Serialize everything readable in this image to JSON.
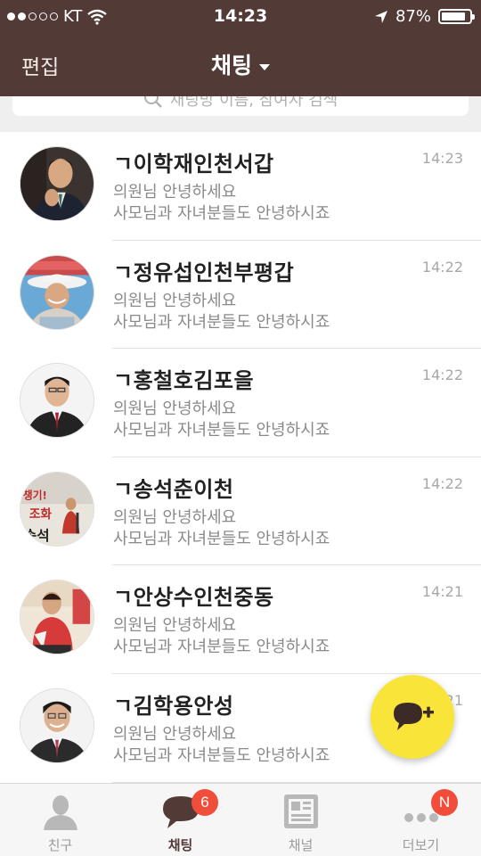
{
  "status_bar": {
    "carrier": "KT",
    "time": "14:23",
    "battery": "87%",
    "battery_level": 0.87
  },
  "header": {
    "edit_label": "편집",
    "title": "채팅"
  },
  "search": {
    "placeholder": "채팅방 이름, 참여자 검색"
  },
  "chats": [
    {
      "name": "ㄱ이학재인천서갑",
      "time": "14:23",
      "line1": "의원님 안녕하세요",
      "line2": "사모님과 자녀분들도 안녕하시죠"
    },
    {
      "name": "ㄱ정유섭인천부평갑",
      "time": "14:22",
      "line1": "의원님 안녕하세요",
      "line2": "사모님과 자녀분들도 안녕하시죠"
    },
    {
      "name": "ㄱ홍철호김포을",
      "time": "14:22",
      "line1": "의원님 안녕하세요",
      "line2": "사모님과 자녀분들도 안녕하시죠"
    },
    {
      "name": "ㄱ송석춘이천",
      "time": "14:22",
      "line1": "의원님 안녕하세요",
      "line2": "사모님과 자녀분들도 안녕하시죠"
    },
    {
      "name": "ㄱ안상수인천중동",
      "time": "14:21",
      "line1": "의원님 안녕하세요",
      "line2": "사모님과 자녀분들도 안녕하시죠"
    },
    {
      "name": "ㄱ김학용안성",
      "time": "14:21",
      "line1": "의원님 안녕하세요",
      "line2": "사모님과 자녀분들도 안녕하시죠"
    }
  ],
  "avatar_texts": {
    "poster_line1": "챙기!",
    "poster_line2": "조화",
    "poster_line3": "송석"
  },
  "tabs": [
    {
      "label": "친구",
      "icon": "person-icon"
    },
    {
      "label": "채팅",
      "icon": "chat-bubble-icon",
      "badge": "6"
    },
    {
      "label": "채널",
      "icon": "channel-icon"
    },
    {
      "label": "더보기",
      "icon": "more-dots-icon",
      "badge": "N"
    }
  ],
  "colors": {
    "header_bg": "#523a36",
    "fab_bg": "#f9e53a",
    "badge_bg": "#f04e3a"
  }
}
